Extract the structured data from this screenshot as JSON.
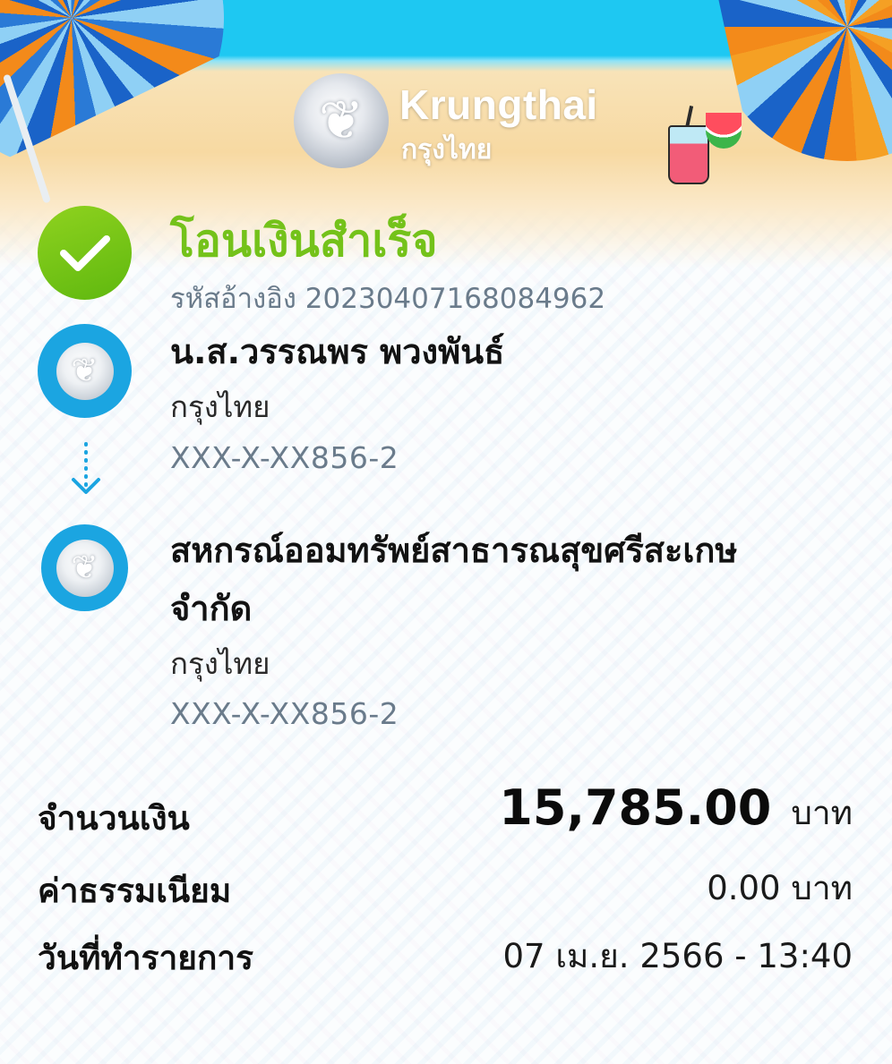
{
  "header": {
    "brand_name_en": "Krungthai",
    "brand_name_th": "กรุงไทย"
  },
  "status": {
    "title": "โอนเงินสำเร็จ",
    "reference_label": "รหัสอ้างอิง",
    "reference_number": "20230407168084962",
    "color": "#74c21a"
  },
  "sender": {
    "name": "น.ส.วรรณพร พวงพันธ์",
    "bank": "กรุงไทย",
    "account": "XXX-X-XX856-2"
  },
  "recipient": {
    "name_line1": "สหกรณ์ออมทรัพย์สาธารณสุขศรีสะเกษ",
    "name_line2": "จำกัด",
    "bank": "กรุงไทย",
    "account": "XXX-X-XX856-2"
  },
  "details": {
    "amount_label": "จำนวนเงิน",
    "amount_value": "15,785.00",
    "amount_unit": "บาท",
    "fee_label": "ค่าธรรมเนียม",
    "fee_value": "0.00 บาท",
    "date_label": "วันที่ทำรายการ",
    "date_value": "07 เม.ย. 2566 - 13:40"
  },
  "icons": {
    "status": "check-circle-icon",
    "bank": "krungthai-emblem-icon",
    "transfer_direction": "dotted-arrow-down-icon"
  },
  "colors": {
    "bank_blue": "#1ba5e1",
    "success_green": "#74c21a",
    "muted_text": "#6a7b8b"
  }
}
